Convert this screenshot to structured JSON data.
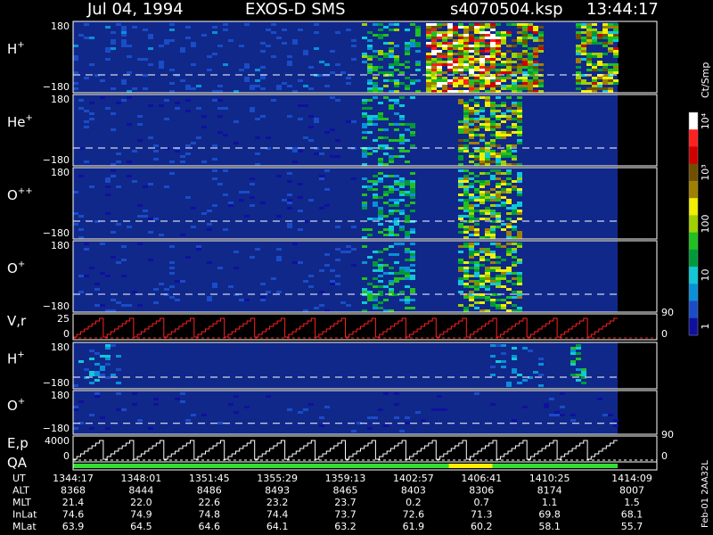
{
  "header": {
    "date": "Jul 04, 1994",
    "instrument": "EXOS-D SMS",
    "file": "s4070504.ksp",
    "time": "13:44:17"
  },
  "colors": {
    "background": "#000000",
    "panel_fill": "#10288a",
    "dash_line": "#ffffff",
    "vr_curve": "#ff2020",
    "ep_curve": "#ffffff",
    "qa_good": "#33dd33",
    "qa_warn": "#ffee00",
    "scale": [
      "#1010a0",
      "#1a4cc8",
      "#0a90d8",
      "#10c8d8",
      "#009a3a",
      "#20c020",
      "#a0d000",
      "#f0f000",
      "#a08000",
      "#705000",
      "#d00000",
      "#ff2020",
      "#ffffff"
    ]
  },
  "chart_data": {
    "type": "heatmap",
    "colorbar": {
      "label": "Ct/Smp",
      "ticks": [
        "1",
        "10",
        "100",
        "10³",
        "10⁴"
      ]
    },
    "panels": [
      {
        "id": "h-plus",
        "label": "H",
        "sup": "+",
        "ytop": "180",
        "ybot": "−180",
        "right": ""
      },
      {
        "id": "he-plus",
        "label": "He",
        "sup": "+",
        "ytop": "180",
        "ybot": "−180",
        "right": ""
      },
      {
        "id": "o-plusplus",
        "label": "O",
        "sup": "++",
        "ytop": "180",
        "ybot": "−180",
        "right": ""
      },
      {
        "id": "o-plus",
        "label": "O",
        "sup": "+",
        "ytop": "180",
        "ybot": "−180",
        "right": "90"
      },
      {
        "id": "vr",
        "label": "V,r",
        "sup": "",
        "ytop": "25",
        "ybot": "0",
        "right": "0"
      },
      {
        "id": "h-plus-2",
        "label": "H",
        "sup": "+",
        "ytop": "180",
        "ybot": "−180",
        "right": ""
      },
      {
        "id": "o-plus-2",
        "label": "O",
        "sup": "+",
        "ytop": "180",
        "ybot": "−180",
        "right": "90"
      },
      {
        "id": "ep",
        "label": "E,p",
        "sup": "",
        "ytop": "4000",
        "ybot": "0",
        "right": "0"
      },
      {
        "id": "qa",
        "label": "QA",
        "sup": "",
        "ytop": "",
        "ybot": "",
        "right": ""
      }
    ],
    "time_table": {
      "rows": [
        {
          "name": "UT",
          "values": [
            "1344:17",
            "1348:01",
            "1351:45",
            "1355:29",
            "1359:13",
            "1402:57",
            "1406:41",
            "1410:25",
            "1414:09"
          ]
        },
        {
          "name": "ALT",
          "values": [
            "8368",
            "8444",
            "8486",
            "8493",
            "8465",
            "8403",
            "8306",
            "8174",
            "8007"
          ]
        },
        {
          "name": "MLT",
          "values": [
            "21.4",
            "22.0",
            "22.6",
            "23.2",
            "23.7",
            "0.2",
            "0.7",
            "1.1",
            "1.5"
          ]
        },
        {
          "name": "InLat",
          "values": [
            "74.6",
            "74.9",
            "74.8",
            "74.4",
            "73.7",
            "72.6",
            "71.3",
            "69.8",
            "68.1"
          ]
        },
        {
          "name": "MLat",
          "values": [
            "63.9",
            "64.5",
            "64.6",
            "64.1",
            "63.2",
            "61.9",
            "60.2",
            "58.1",
            "55.7"
          ]
        }
      ]
    },
    "side_label": "Feb-01 2AA32L",
    "sweep": {
      "cycles": 18,
      "steps_per_cycle": 8
    },
    "qa_warn_span": [
      0.69,
      0.77
    ],
    "intensity": {
      "h-plus": {
        "events": [
          [
            0.64,
            0.78,
            0.95
          ],
          [
            0.78,
            0.86,
            0.75
          ],
          [
            0.92,
            1.0,
            0.7
          ],
          [
            0.53,
            0.63,
            0.45
          ],
          [
            0.0,
            0.52,
            0.12
          ]
        ]
      },
      "he-plus": {
        "events": [
          [
            0.7,
            0.82,
            0.65
          ],
          [
            0.53,
            0.62,
            0.4
          ],
          [
            0.0,
            0.52,
            0.07
          ]
        ]
      },
      "o-plusplus": {
        "events": [
          [
            0.7,
            0.82,
            0.6
          ],
          [
            0.53,
            0.62,
            0.4
          ],
          [
            0.0,
            0.52,
            0.07
          ]
        ]
      },
      "o-plus": {
        "events": [
          [
            0.7,
            0.82,
            0.6
          ],
          [
            0.53,
            0.62,
            0.4
          ],
          [
            0.0,
            0.52,
            0.07
          ]
        ]
      },
      "h-plus-2": {
        "events": [
          [
            0.0,
            0.08,
            0.22
          ],
          [
            0.76,
            0.86,
            0.2
          ],
          [
            0.91,
            0.94,
            0.4
          ]
        ]
      },
      "o-plus-2": {
        "events": [
          [
            0.0,
            1.0,
            0.05
          ]
        ]
      }
    }
  }
}
